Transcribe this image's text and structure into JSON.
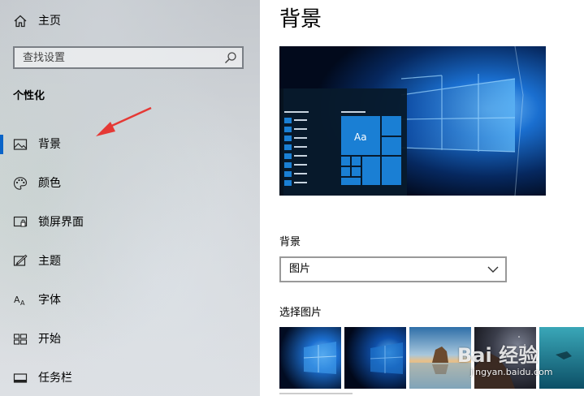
{
  "sidebar": {
    "home_label": "主页",
    "search_placeholder": "查找设置",
    "section_title": "个性化",
    "items": [
      {
        "label": "背景",
        "icon": "picture-icon",
        "active": true
      },
      {
        "label": "颜色",
        "icon": "palette-icon"
      },
      {
        "label": "锁屏界面",
        "icon": "lock-screen-icon"
      },
      {
        "label": "主题",
        "icon": "theme-icon"
      },
      {
        "label": "字体",
        "icon": "font-icon"
      },
      {
        "label": "开始",
        "icon": "start-icon"
      },
      {
        "label": "任务栏",
        "icon": "taskbar-icon"
      }
    ],
    "annotation": "red-arrow-pointing-to-background"
  },
  "main": {
    "title": "背景",
    "preview_tile_text": "Aa",
    "background_label": "背景",
    "background_type": "图片",
    "choose_label": "选择图片",
    "thumbnails": [
      "windows-hero-blue",
      "windows-hero-blue-dark",
      "beach-rock-sunset",
      "rock-night-sky",
      "underwater-swimmer"
    ]
  },
  "watermark": {
    "logo": "Bai 经验",
    "url": "jingyan.baidu.com"
  },
  "colors": {
    "accent": "#0a64c8",
    "arrow": "#e53935",
    "tile": "#1a7fd4"
  }
}
